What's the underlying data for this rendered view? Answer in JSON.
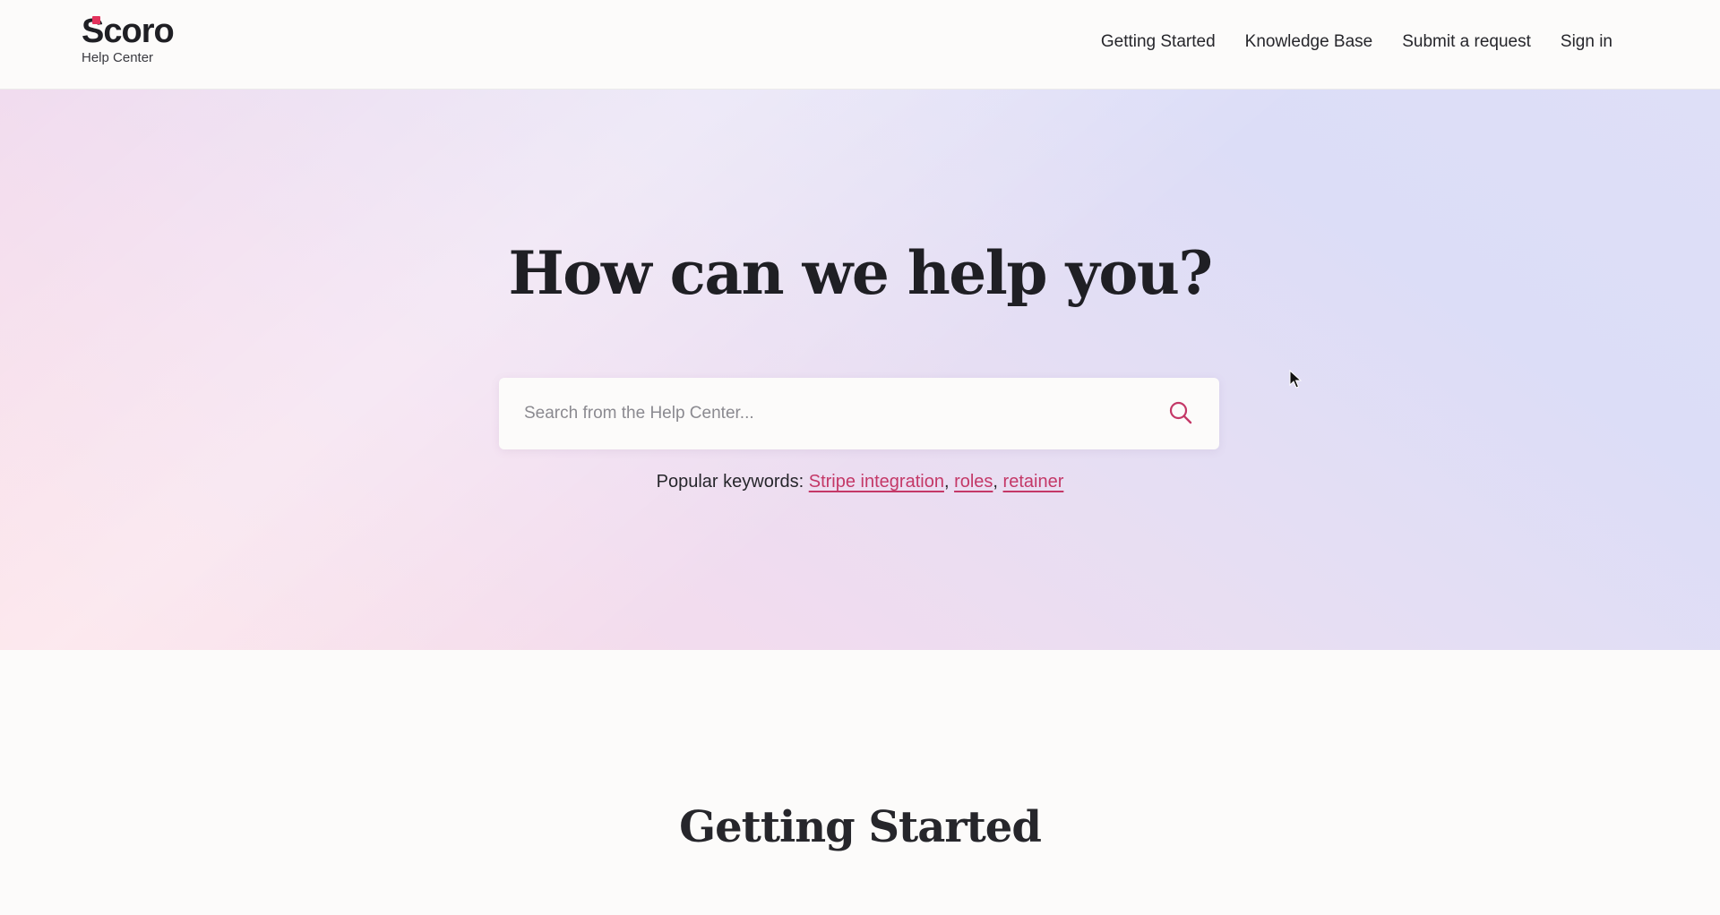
{
  "header": {
    "logo": {
      "wordmark": "Scoro",
      "subtitle": "Help Center"
    },
    "nav": [
      {
        "label": "Getting Started"
      },
      {
        "label": "Knowledge Base"
      },
      {
        "label": "Submit a request"
      },
      {
        "label": "Sign in"
      }
    ]
  },
  "hero": {
    "title": "How can we help you?",
    "search": {
      "placeholder": "Search from the Help Center...",
      "value": "",
      "icon": "search-icon"
    },
    "keywords": {
      "label": "Popular keywords:",
      "items": [
        "Stripe integration",
        "roles",
        "retainer"
      ],
      "separator": ","
    }
  },
  "section": {
    "title": "Getting Started"
  },
  "colors": {
    "brand_accent": "#e3325c",
    "link": "#c43867",
    "text": "#1f1f24",
    "background": "#fcfbfa"
  }
}
